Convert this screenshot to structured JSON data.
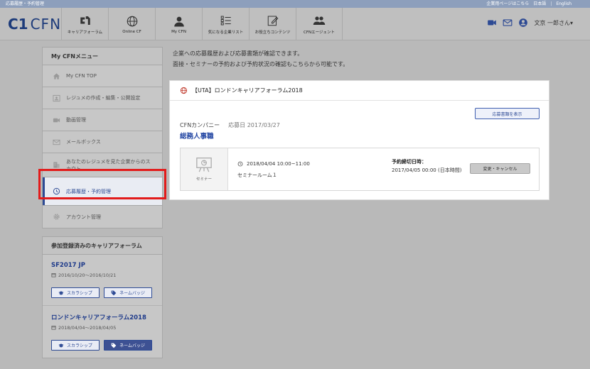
{
  "topbar": {
    "breadcrumb": "応募履歴・予約管理",
    "corporate_link": "企業用ページはこちら",
    "lang_ja": "日本語",
    "lang_sep": "|",
    "lang_en": "English"
  },
  "header": {
    "logo_mark": "C1",
    "logo_text": "CFN",
    "nav": [
      {
        "label": "キャリアフォーラム",
        "icon": "c1-logo-icon"
      },
      {
        "label": "Online CF",
        "icon": "globe-icon"
      },
      {
        "label": "My CFN",
        "icon": "person-icon"
      },
      {
        "label": "気になる企業リスト",
        "icon": "checklist-icon"
      },
      {
        "label": "お役立ちコンテンツ",
        "icon": "pencil-icon"
      },
      {
        "label": "CFNエージェント",
        "icon": "people-icon"
      }
    ],
    "user_name": "文京 一郎さん▾"
  },
  "sidebar": {
    "title": "My CFNメニュー",
    "items": [
      {
        "label": "My CFN TOP",
        "icon": "home-icon"
      },
      {
        "label": "レジュメの作成・編集・公開設定",
        "icon": "resume-icon"
      },
      {
        "label": "動画管理",
        "icon": "video-icon"
      },
      {
        "label": "メールボックス",
        "icon": "mail-icon"
      },
      {
        "label": "あなたのレジュメを見た企業からのスカウト",
        "icon": "building-icon"
      },
      {
        "label": "応募履歴・予約管理",
        "icon": "history-icon"
      },
      {
        "label": "アカウント管理",
        "icon": "gear-icon"
      }
    ]
  },
  "fairs": {
    "title": "参加登録済みのキャリアフォーラム",
    "items": [
      {
        "name": "SF2017 JP",
        "dates": "2016/10/20〜2016/10/21",
        "scholarship": "スカラシップ",
        "badge": "ネームバッジ"
      },
      {
        "name": "ロンドンキャリアフォーラム2018",
        "dates": "2018/04/04〜2018/04/05",
        "scholarship": "スカラシップ",
        "badge": "ネームバッジ"
      }
    ]
  },
  "main": {
    "intro_line1": "企業への応募履歴および応募書類が確認できます。",
    "intro_line2": "面接・セミナーの予約および予約状況の確認もこちらから可能です。",
    "card": {
      "event_title": "【UTA】ロンドンキャリアフォーラム2018",
      "show_docs": "応募書類を表示",
      "company": "CFNカンパニー",
      "applied": "応募日 2017/03/27",
      "job": "総務人事職",
      "event_type": "セミナー",
      "event_time": "2018/04/04 10:00~11:00",
      "event_room": "セミナールーム１",
      "deadline_label": "予約締切日時：",
      "deadline_value": "2017/04/05 00:00 (日本時間)",
      "change_button": "変更・キャンセル"
    }
  },
  "colors": {
    "accent": "#2d4a94",
    "highlight": "#e21b1b",
    "topbar": "#8d9fbc"
  }
}
